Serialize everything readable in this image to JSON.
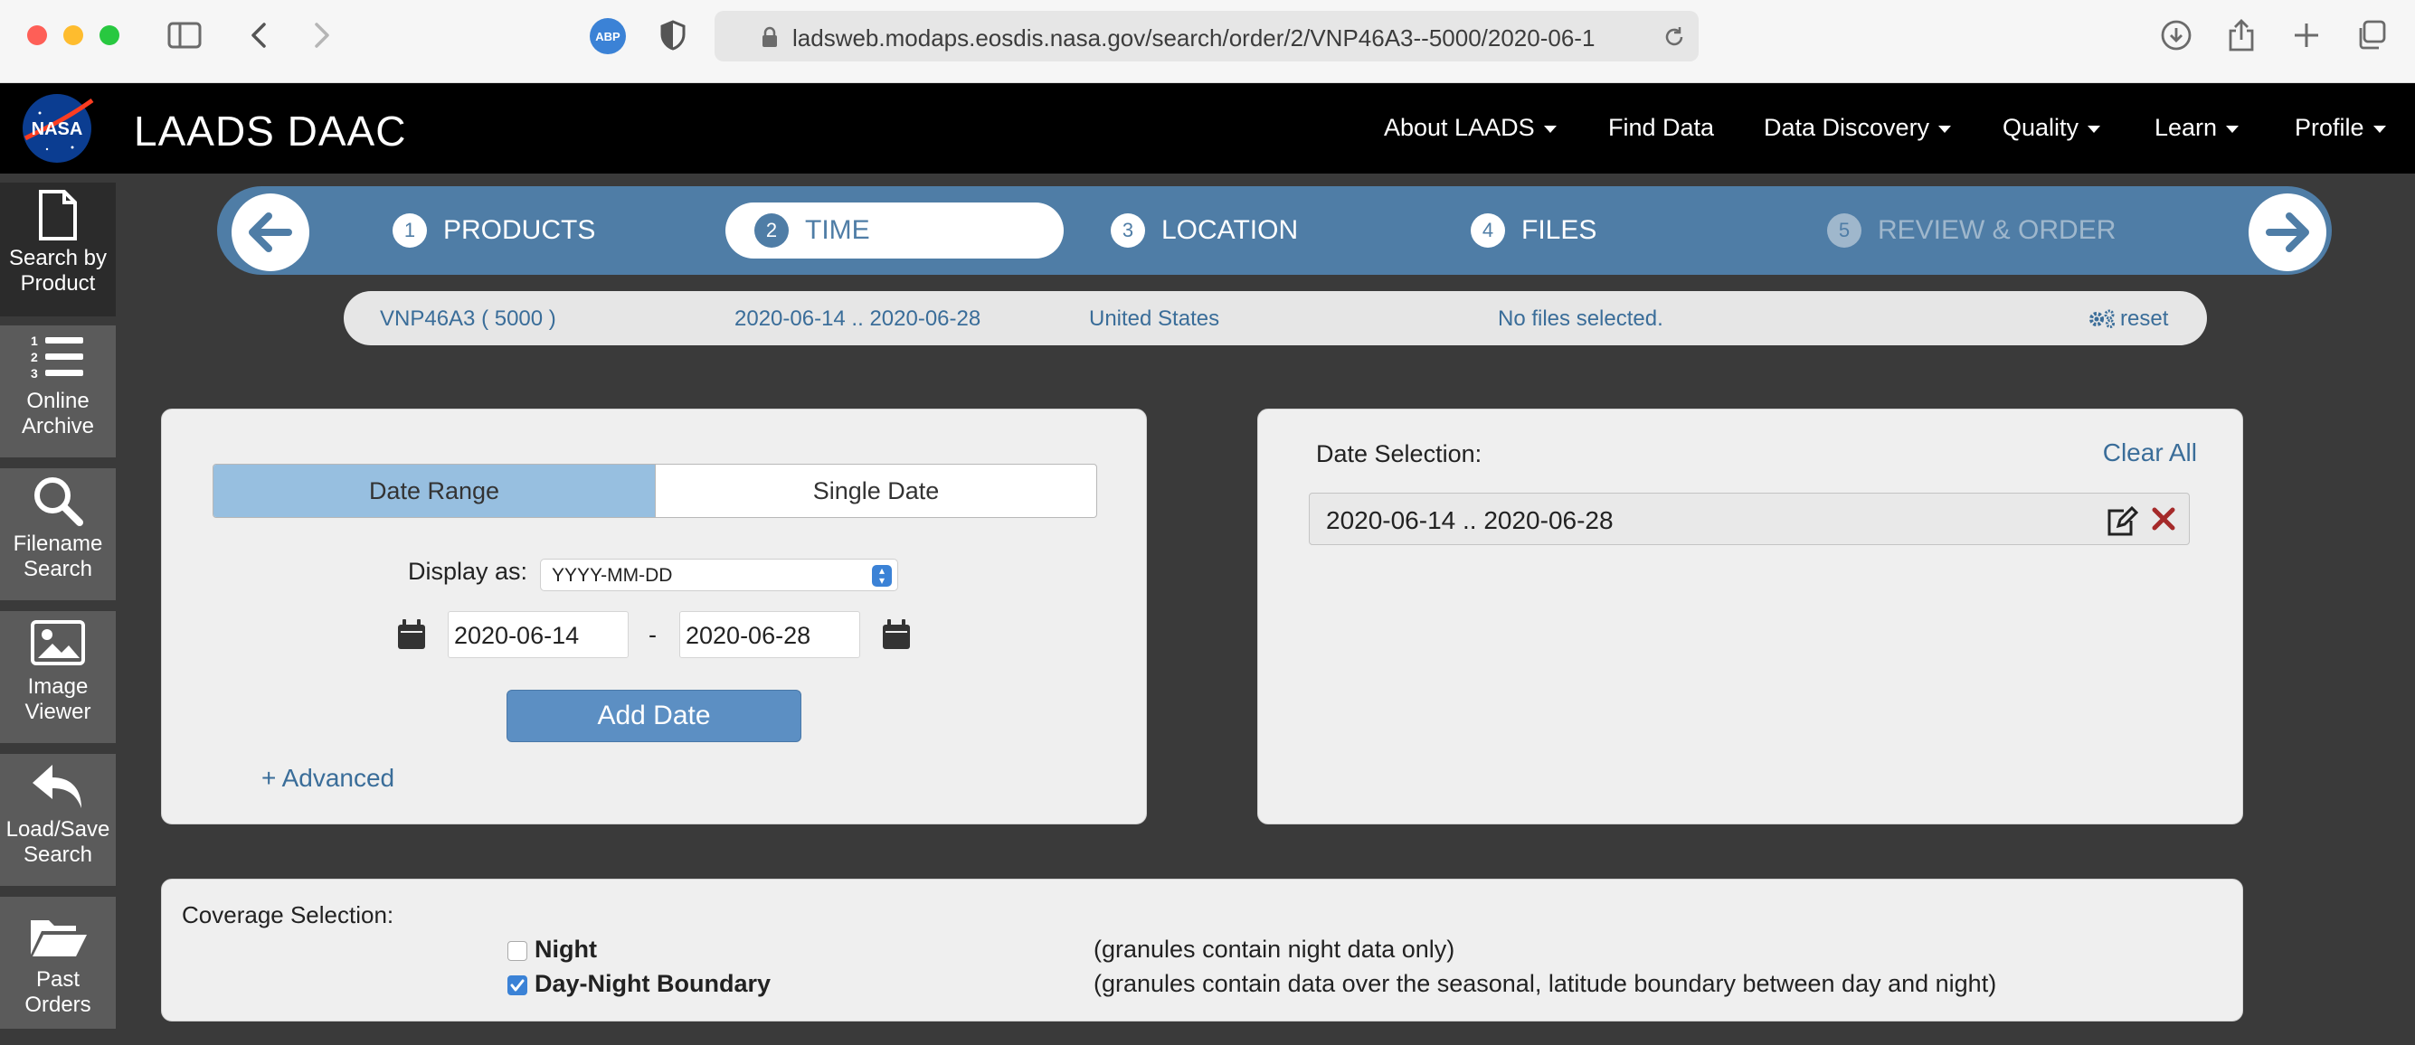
{
  "browser": {
    "url": "ladsweb.modaps.eosdis.nasa.gov/search/order/2/VNP46A3--5000/2020-06-1",
    "abp_label": "ABP"
  },
  "site": {
    "name": "LAADS DAAC",
    "logo_text": "NASA",
    "nav": [
      {
        "label": "About LAADS",
        "has_caret": true
      },
      {
        "label": "Find Data",
        "has_caret": false
      },
      {
        "label": "Data Discovery",
        "has_caret": true
      },
      {
        "label": "Quality",
        "has_caret": true
      },
      {
        "label": "Learn",
        "has_caret": true
      },
      {
        "label": "Profile",
        "has_caret": true
      }
    ]
  },
  "sidebar": [
    {
      "line1": "Search by",
      "line2": "Product",
      "icon": "file-icon",
      "active": true
    },
    {
      "line1": "Online",
      "line2": "Archive",
      "icon": "numbered-list-icon",
      "active": false
    },
    {
      "line1": "Filename",
      "line2": "Search",
      "icon": "search-icon",
      "active": false
    },
    {
      "line1": "Image",
      "line2": "Viewer",
      "icon": "image-icon",
      "active": false
    },
    {
      "line1": "Load/Save",
      "line2": "Search",
      "icon": "reply-icon",
      "active": false
    },
    {
      "line1": "Past Orders",
      "line2": "",
      "icon": "folder-open-icon",
      "active": false
    }
  ],
  "steps": [
    {
      "num": "1",
      "label": "PRODUCTS",
      "state": "normal"
    },
    {
      "num": "2",
      "label": "TIME",
      "state": "active"
    },
    {
      "num": "3",
      "label": "LOCATION",
      "state": "normal"
    },
    {
      "num": "4",
      "label": "FILES",
      "state": "normal"
    },
    {
      "num": "5",
      "label": "REVIEW & ORDER",
      "state": "disabled"
    }
  ],
  "summary": {
    "product": "VNP46A3 ( 5000 )",
    "dates": "2020-06-14 .. 2020-06-28",
    "location": "United States",
    "files": "No files selected.",
    "reset": "reset"
  },
  "date_panel": {
    "tab_range": "Date Range",
    "tab_single": "Single Date",
    "display_label": "Display as:",
    "display_format": "YYYY-MM-DD",
    "start_date": "2020-06-14",
    "separator": "-",
    "end_date": "2020-06-28",
    "add_button": "Add Date",
    "advanced": "+ Advanced"
  },
  "selection_panel": {
    "title": "Date Selection:",
    "clear_all": "Clear All",
    "selected_range": "2020-06-14 .. 2020-06-28"
  },
  "coverage": {
    "title": "Coverage Selection:",
    "options": [
      {
        "label": "Night",
        "desc": "(granules contain night data only)",
        "checked": false
      },
      {
        "label": "Day-Night Boundary",
        "desc": "(granules contain data over the seasonal, latitude boundary between day and night)",
        "checked": true
      }
    ]
  },
  "colors": {
    "accent_blue": "#4f7da6",
    "link_blue": "#3a6d99",
    "header_bg": "#000000",
    "page_bg": "#3a3a3a",
    "active_toggle": "#97bfe0"
  }
}
